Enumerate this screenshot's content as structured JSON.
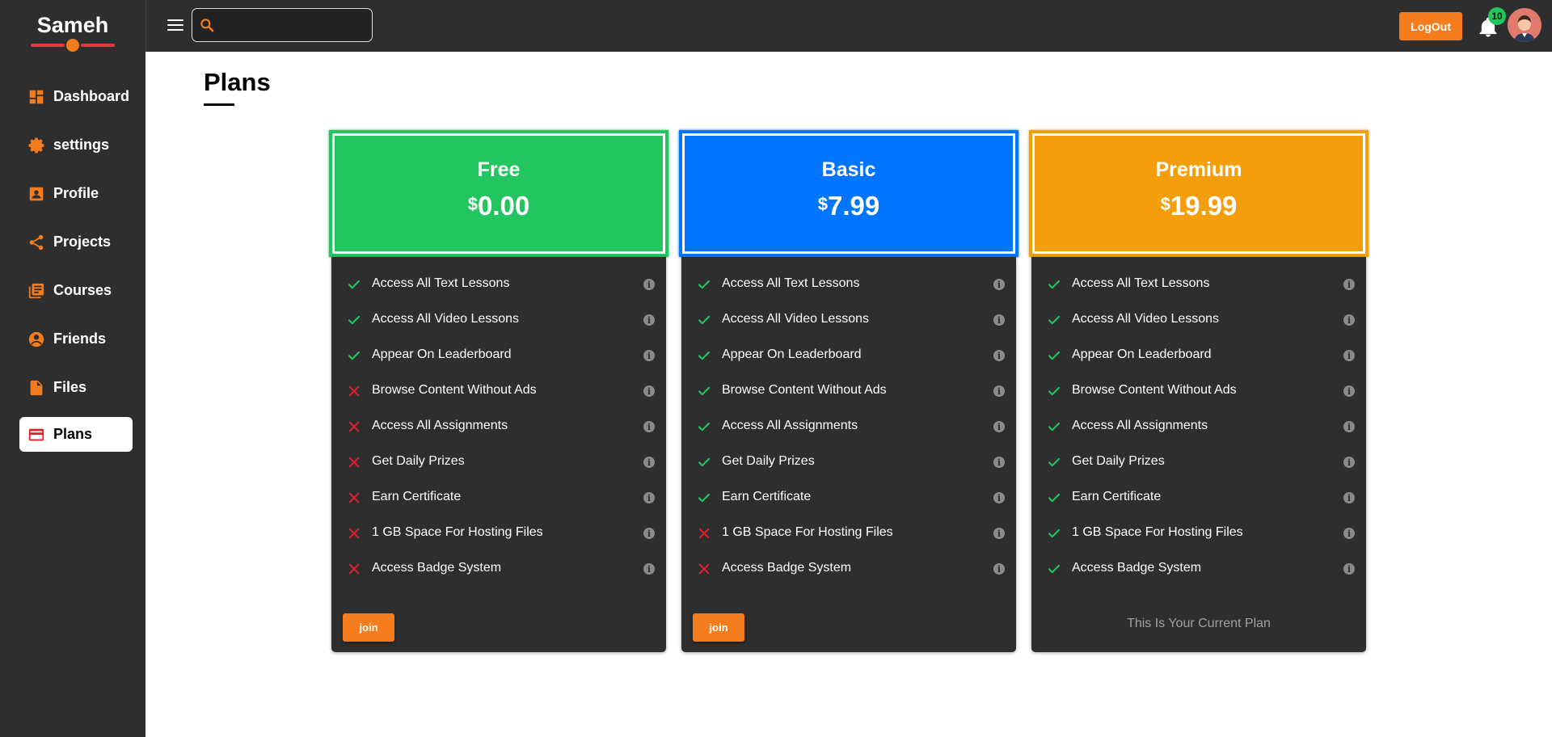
{
  "brand": {
    "name": "Sameh"
  },
  "sidebar": {
    "items": [
      {
        "label": "Dashboard",
        "icon": "dashboard-icon",
        "active": false
      },
      {
        "label": "settings",
        "icon": "gear-icon",
        "active": false
      },
      {
        "label": "Profile",
        "icon": "profile-card-icon",
        "active": false
      },
      {
        "label": "Projects",
        "icon": "share-icon",
        "active": false
      },
      {
        "label": "Courses",
        "icon": "library-icon",
        "active": false
      },
      {
        "label": "Friends",
        "icon": "user-circle-icon",
        "active": false
      },
      {
        "label": "Files",
        "icon": "file-icon",
        "active": false
      },
      {
        "label": "Plans",
        "icon": "credit-card-icon",
        "active": true
      }
    ]
  },
  "topbar": {
    "search_value": "",
    "logout_label": "LogOut",
    "notifications_count": "10"
  },
  "page": {
    "title": "Plans"
  },
  "colors": {
    "accent": "#f47c1c",
    "free": "#22c55e",
    "basic": "#0075ff",
    "premium": "#f59e0b",
    "check": "#22c55e",
    "cross": "#e11d2a"
  },
  "plans": [
    {
      "name": "Free",
      "currency": "$",
      "price": "0.00",
      "color": "#22c55e",
      "features": [
        {
          "label": "Access All Text Lessons",
          "included": true
        },
        {
          "label": "Access All Video Lessons",
          "included": true
        },
        {
          "label": "Appear On Leaderboard",
          "included": true
        },
        {
          "label": "Browse Content Without Ads",
          "included": false
        },
        {
          "label": "Access All Assignments",
          "included": false
        },
        {
          "label": "Get Daily Prizes",
          "included": false
        },
        {
          "label": "Earn Certificate",
          "included": false
        },
        {
          "label": "1 GB Space For Hosting Files",
          "included": false
        },
        {
          "label": "Access Badge System",
          "included": false
        }
      ],
      "action_label": "join"
    },
    {
      "name": "Basic",
      "currency": "$",
      "price": "7.99",
      "color": "#0075ff",
      "features": [
        {
          "label": "Access All Text Lessons",
          "included": true
        },
        {
          "label": "Access All Video Lessons",
          "included": true
        },
        {
          "label": "Appear On Leaderboard",
          "included": true
        },
        {
          "label": "Browse Content Without Ads",
          "included": true
        },
        {
          "label": "Access All Assignments",
          "included": true
        },
        {
          "label": "Get Daily Prizes",
          "included": true
        },
        {
          "label": "Earn Certificate",
          "included": true
        },
        {
          "label": "1 GB Space For Hosting Files",
          "included": false
        },
        {
          "label": "Access Badge System",
          "included": false
        }
      ],
      "action_label": "join"
    },
    {
      "name": "Premium",
      "currency": "$",
      "price": "19.99",
      "color": "#f59e0b",
      "features": [
        {
          "label": "Access All Text Lessons",
          "included": true
        },
        {
          "label": "Access All Video Lessons",
          "included": true
        },
        {
          "label": "Appear On Leaderboard",
          "included": true
        },
        {
          "label": "Browse Content Without Ads",
          "included": true
        },
        {
          "label": "Access All Assignments",
          "included": true
        },
        {
          "label": "Get Daily Prizes",
          "included": true
        },
        {
          "label": "Earn Certificate",
          "included": true
        },
        {
          "label": "1 GB Space For Hosting Files",
          "included": true
        },
        {
          "label": "Access Badge System",
          "included": true
        }
      ],
      "current_label": "This Is Your Current Plan"
    }
  ]
}
